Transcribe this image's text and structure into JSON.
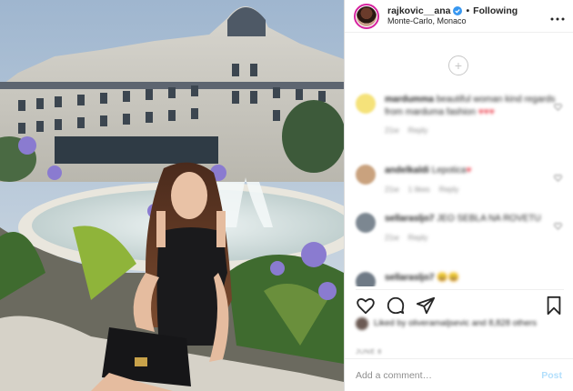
{
  "header": {
    "username": "rajkovic__ana",
    "separator": "•",
    "follow_status": "Following",
    "location": "Monte-Carlo, Monaco",
    "more_icon": "more-horizontal-icon"
  },
  "comments": [
    {
      "user": "mardumma",
      "text": "beautiful woman kind regards from marduma fashion",
      "hearts": "♥♥♥",
      "meta": [
        "21w",
        "Reply"
      ]
    },
    {
      "user": "andelkaldi",
      "text": "Lepotica",
      "hearts": "♥",
      "meta": [
        "21w",
        "1 likes",
        "Reply"
      ]
    },
    {
      "user": "sellarasljo7",
      "text": "JEO SEBLA NA ROVETU",
      "hearts": "",
      "meta": [
        "21w",
        "Reply"
      ]
    },
    {
      "user": "sellarasljo7",
      "text": "😀😀",
      "hearts": "",
      "meta": []
    }
  ],
  "likes": {
    "text": "Liked by oliveramaljsevic and 8,828 others"
  },
  "timestamp": "JUNE 8",
  "add_comment": {
    "placeholder": "Add a comment…",
    "post_label": "Post"
  },
  "colors": {
    "story_ring": "#d6249f",
    "verified": "#3897f0",
    "post_disabled": "#b2dffc",
    "heart": "#ed4956"
  }
}
